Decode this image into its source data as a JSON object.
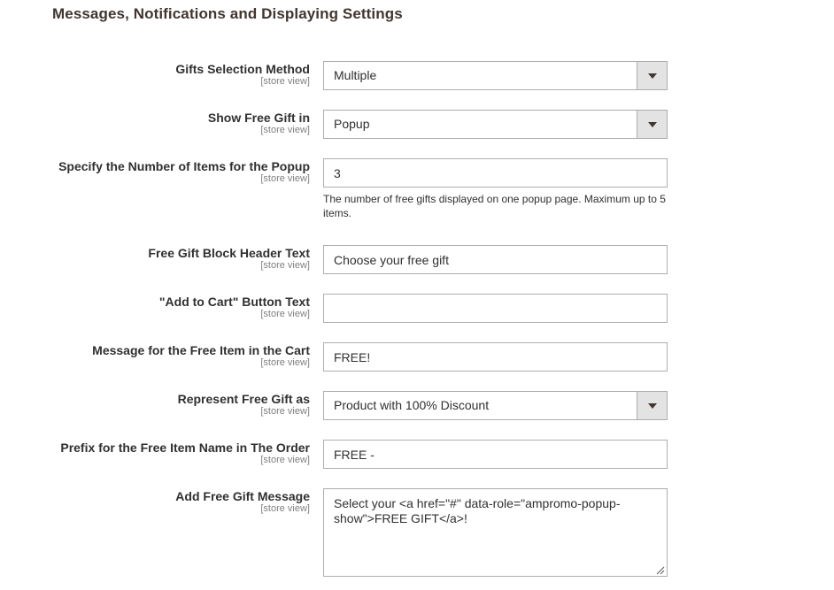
{
  "section": {
    "title": "Messages, Notifications and Displaying Settings"
  },
  "fields": {
    "gifts_selection_method": {
      "label": "Gifts Selection Method",
      "scope": "[store view]",
      "value": "Multiple"
    },
    "show_free_gift_in": {
      "label": "Show Free Gift in",
      "scope": "[store view]",
      "value": "Popup"
    },
    "popup_items_number": {
      "label": "Specify the Number of Items for the Popup",
      "scope": "[store view]",
      "value": "3",
      "note": "The number of free gifts displayed on one popup page. Maximum up to 5 items."
    },
    "block_header_text": {
      "label": "Free Gift Block Header Text",
      "scope": "[store view]",
      "value": "Choose your free gift"
    },
    "add_to_cart_text": {
      "label": "\"Add to Cart\" Button Text",
      "scope": "[store view]",
      "value": ""
    },
    "free_item_cart_message": {
      "label": "Message for the Free Item in the Cart",
      "scope": "[store view]",
      "value": "FREE!"
    },
    "represent_free_gift_as": {
      "label": "Represent Free Gift as",
      "scope": "[store view]",
      "value": "Product with 100% Discount"
    },
    "free_item_name_prefix": {
      "label": "Prefix for the Free Item Name in The Order",
      "scope": "[store view]",
      "value": "FREE -"
    },
    "add_free_gift_message": {
      "label": "Add Free Gift Message",
      "scope": "[store view]",
      "value": "Select your <a href=\"#\" data-role=\"ampromo-popup-show\">FREE GIFT</a>!"
    }
  },
  "icons": {
    "select_arrow": "chevron-down-icon",
    "textarea_grip": "resize-grip-icon"
  }
}
